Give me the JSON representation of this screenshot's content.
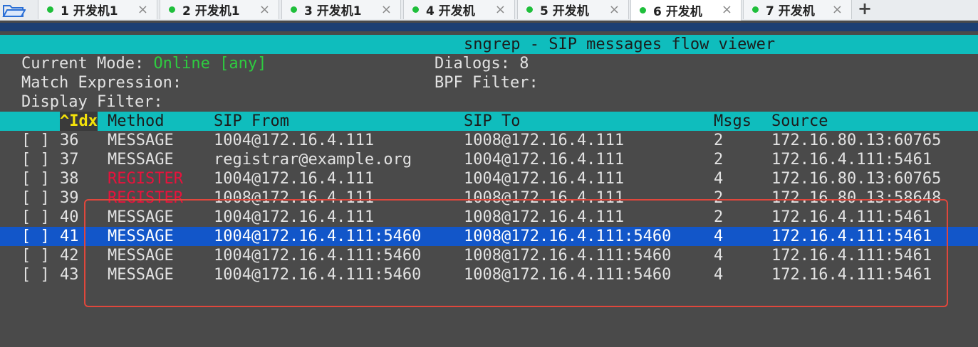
{
  "tabs": [
    {
      "label": "1 开发机1",
      "close": "×"
    },
    {
      "label": "2 开发机1",
      "close": "×"
    },
    {
      "label": "3 开发机1",
      "close": "×"
    },
    {
      "label": "4 开发机",
      "close": "×"
    },
    {
      "label": "5 开发机",
      "close": "×"
    },
    {
      "label": "6 开发机",
      "close": "×"
    },
    {
      "label": "7 开发机",
      "close": "×"
    }
  ],
  "new_tab": "+",
  "title": "sngrep - SIP messages flow viewer",
  "info": {
    "mode_label": "Current Mode: ",
    "mode_value": "Online [any]",
    "dialogs": "Dialogs: 8",
    "match": "Match Expression:",
    "bpf": "BPF Filter:",
    "display": "Display Filter:"
  },
  "columns": {
    "idx": "^Idx",
    "method": "Method",
    "from": "SIP From",
    "to": "SIP To",
    "msgs": "Msgs",
    "source": "Source"
  },
  "rows": [
    {
      "check": "[ ]",
      "idx": "36",
      "method": "MESSAGE",
      "from": "1004@172.16.4.111",
      "to": "1008@172.16.4.111",
      "msgs": "2",
      "source": "172.16.80.13:60765"
    },
    {
      "check": "[ ]",
      "idx": "37",
      "method": "MESSAGE",
      "from": "registrar@example.org",
      "to": "1004@172.16.4.111",
      "msgs": "2",
      "source": "172.16.4.111:5461"
    },
    {
      "check": "[ ]",
      "idx": "38",
      "method": "REGISTER",
      "from": "1004@172.16.4.111",
      "to": "1004@172.16.4.111",
      "msgs": "4",
      "source": "172.16.80.13:60765"
    },
    {
      "check": "[ ]",
      "idx": "39",
      "method": "REGISTER",
      "from": "1008@172.16.4.111",
      "to": "1008@172.16.4.111",
      "msgs": "2",
      "source": "172.16.80.13:58648"
    },
    {
      "check": "[ ]",
      "idx": "40",
      "method": "MESSAGE",
      "from": "1004@172.16.4.111",
      "to": "1008@172.16.4.111",
      "msgs": "2",
      "source": "172.16.4.111:5461"
    },
    {
      "check": "[ ]",
      "idx": "41",
      "method": "MESSAGE",
      "from": "1004@172.16.4.111:5460",
      "to": "1008@172.16.4.111:5460",
      "msgs": "4",
      "source": "172.16.4.111:5461"
    },
    {
      "check": "[ ]",
      "idx": "42",
      "method": "MESSAGE",
      "from": "1004@172.16.4.111:5460",
      "to": "1008@172.16.4.111:5460",
      "msgs": "4",
      "source": "172.16.4.111:5461"
    },
    {
      "check": "[ ]",
      "idx": "43",
      "method": "MESSAGE",
      "from": "1004@172.16.4.111:5460",
      "to": "1008@172.16.4.111:5460",
      "msgs": "4",
      "source": "172.16.4.111:5461"
    }
  ]
}
